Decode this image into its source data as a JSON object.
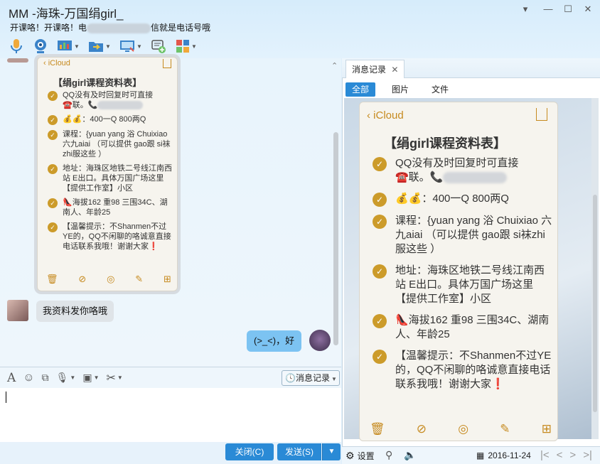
{
  "window": {
    "title": "MM -海珠-万国绢girl_",
    "subtitle_before": "开课咯！开课咯！电",
    "subtitle_after": "信就是电话号哦",
    "min": "▾",
    "minimize": "—",
    "maximize": "☐",
    "close": "✕"
  },
  "toolbar": {
    "icons": [
      "voice-call-icon",
      "video-call-icon",
      "share-screen-icon",
      "file-transfer-icon",
      "remote-desktop-icon",
      "invite-icon",
      "apps-icon"
    ]
  },
  "note": {
    "back": "iCloud",
    "heading": "【绢girl课程资料表】",
    "items": [
      {
        "text_a": "QQ没有及时回复时可直接",
        "text_b": "☎️联。📞"
      },
      {
        "text_a": "💰💰：400一Q  800两Q",
        "text_b": ""
      },
      {
        "text_a": "课程：{yuan yang 浴 Chuixiao 六九aiai （可以提供 gao跟 si袜zhi服这些 ）",
        "text_b": ""
      },
      {
        "text_a": "地址：海珠区地铁二号线江南西站 E出口。具体万国广场这里【提供工作室】小区",
        "text_b": ""
      },
      {
        "text_a": "👠海拔162 重98 三围34C、湖南人、年龄25",
        "text_b": ""
      },
      {
        "text_a": "【温馨提示：不Shanmen不过YE的，QQ不闲聊的咯诚意直接电话联系我哦！谢谢大家❗",
        "text_b": ""
      }
    ]
  },
  "messages": {
    "left": "我资料发你咯哦",
    "right": "(>_<)，好"
  },
  "input": {
    "history_label": "消息记录"
  },
  "buttons": {
    "close": "关闭(C)",
    "send": "发送(S)",
    "send_menu": "▼"
  },
  "history": {
    "tab_label": "消息记录",
    "tab_close": "✕",
    "filters": [
      "全部",
      "图片",
      "文件"
    ],
    "settings": "设置",
    "date": "2016-11-24",
    "pager": [
      "|<",
      "<",
      ">",
      ">|"
    ]
  }
}
